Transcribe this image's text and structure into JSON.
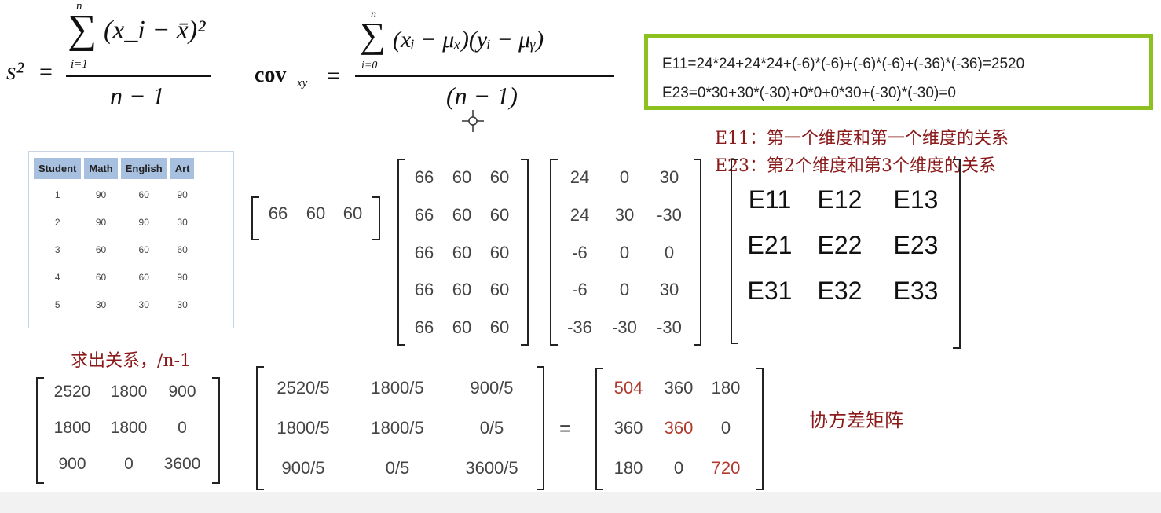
{
  "formulas": {
    "variance": {
      "lhs": "s²",
      "numer_sigma_top": "n",
      "numer_sigma_bottom": "i=1",
      "numer_body": "(x_i − x̄)²",
      "denom": "n − 1"
    },
    "covariance": {
      "lhs": "cov",
      "lhs_sub": "xy",
      "numer_sigma_top": "n",
      "numer_sigma_bottom": "i=0",
      "numer_body": "(xᵢ − μₓ)(yᵢ − μᵧ)",
      "denom": "(n − 1)"
    }
  },
  "highlight_box": {
    "line1": "E11=24*24+24*24+(-6)*(-6)+(-6)*(-6)+(-36)*(-36)=2520",
    "line2": "E23=0*30+30*(-30)+0*0+0*30+(-30)*(-30)=0",
    "border_color": "#8cc11f"
  },
  "notes": {
    "e11_note": "E11：第一个维度和第一个维度的关系",
    "e23_note": "E23：第2个维度和第3个维度的关系",
    "relation_note": "求出关系，/n-1",
    "cov_matrix_note": "协方差矩阵",
    "note_color": "#8b1a1a"
  },
  "student_table": {
    "headers": [
      "Student",
      "Math",
      "English",
      "Art"
    ],
    "rows": [
      [
        "1",
        "90",
        "60",
        "90"
      ],
      [
        "2",
        "90",
        "90",
        "30"
      ],
      [
        "3",
        "60",
        "60",
        "60"
      ],
      [
        "4",
        "60",
        "60",
        "90"
      ],
      [
        "5",
        "30",
        "30",
        "30"
      ]
    ]
  },
  "mean_row": [
    "66",
    "60",
    "60"
  ],
  "mean_matrix": [
    [
      "66",
      "60",
      "60"
    ],
    [
      "66",
      "60",
      "60"
    ],
    [
      "66",
      "60",
      "60"
    ],
    [
      "66",
      "60",
      "60"
    ],
    [
      "66",
      "60",
      "60"
    ]
  ],
  "deviation_matrix": [
    [
      "24",
      "0",
      "30"
    ],
    [
      "24",
      "30",
      "-30"
    ],
    [
      "-6",
      "0",
      "0"
    ],
    [
      "-6",
      "0",
      "30"
    ],
    [
      "-36",
      "-30",
      "-30"
    ]
  ],
  "e_matrix": [
    [
      "E11",
      "E12",
      "E13"
    ],
    [
      "E21",
      "E22",
      "E23"
    ],
    [
      "E31",
      "E32",
      "E33"
    ]
  ],
  "sum_matrix": [
    [
      "2520",
      "1800",
      "900"
    ],
    [
      "1800",
      "1800",
      "0"
    ],
    [
      "900",
      "0",
      "3600"
    ]
  ],
  "divided_matrix": [
    [
      "2520/5",
      "1800/5",
      "900/5"
    ],
    [
      "1800/5",
      "1800/5",
      "0/5"
    ],
    [
      "900/5",
      "0/5",
      "3600/5"
    ]
  ],
  "equals_sign": "=",
  "cov_matrix": [
    [
      "504",
      "360",
      "180"
    ],
    [
      "360",
      "360",
      "0"
    ],
    [
      "180",
      "0",
      "720"
    ]
  ],
  "diagonal_color": "#b03a2e"
}
